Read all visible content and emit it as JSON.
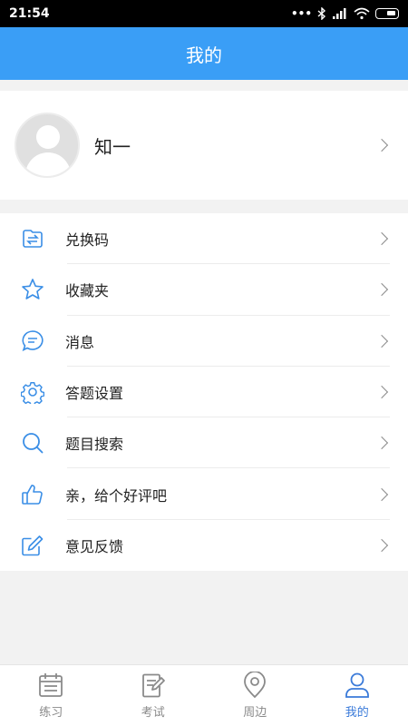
{
  "status": {
    "time": "21:54",
    "dots": "•••"
  },
  "header": {
    "title": "我的"
  },
  "profile": {
    "name": "知一"
  },
  "menu": {
    "items": [
      {
        "label": "兑换码",
        "icon": "exchange-icon"
      },
      {
        "label": "收藏夹",
        "icon": "star-icon"
      },
      {
        "label": "消息",
        "icon": "message-icon"
      },
      {
        "label": "答题设置",
        "icon": "gear-icon"
      },
      {
        "label": "题目搜索",
        "icon": "search-icon"
      },
      {
        "label": "亲，给个好评吧",
        "icon": "thumbs-up-icon"
      },
      {
        "label": "意见反馈",
        "icon": "edit-icon"
      }
    ]
  },
  "tabs": [
    {
      "label": "练习",
      "icon": "calendar-icon",
      "active": false
    },
    {
      "label": "考试",
      "icon": "exam-icon",
      "active": false
    },
    {
      "label": "周边",
      "icon": "location-icon",
      "active": false
    },
    {
      "label": "我的",
      "icon": "person-icon",
      "active": true
    }
  ],
  "colors": {
    "accent": "#3a9ef6",
    "icon_blue": "#3a8ee6",
    "tab_active": "#3a7ad9",
    "tab_inactive": "#8a8a8a"
  }
}
